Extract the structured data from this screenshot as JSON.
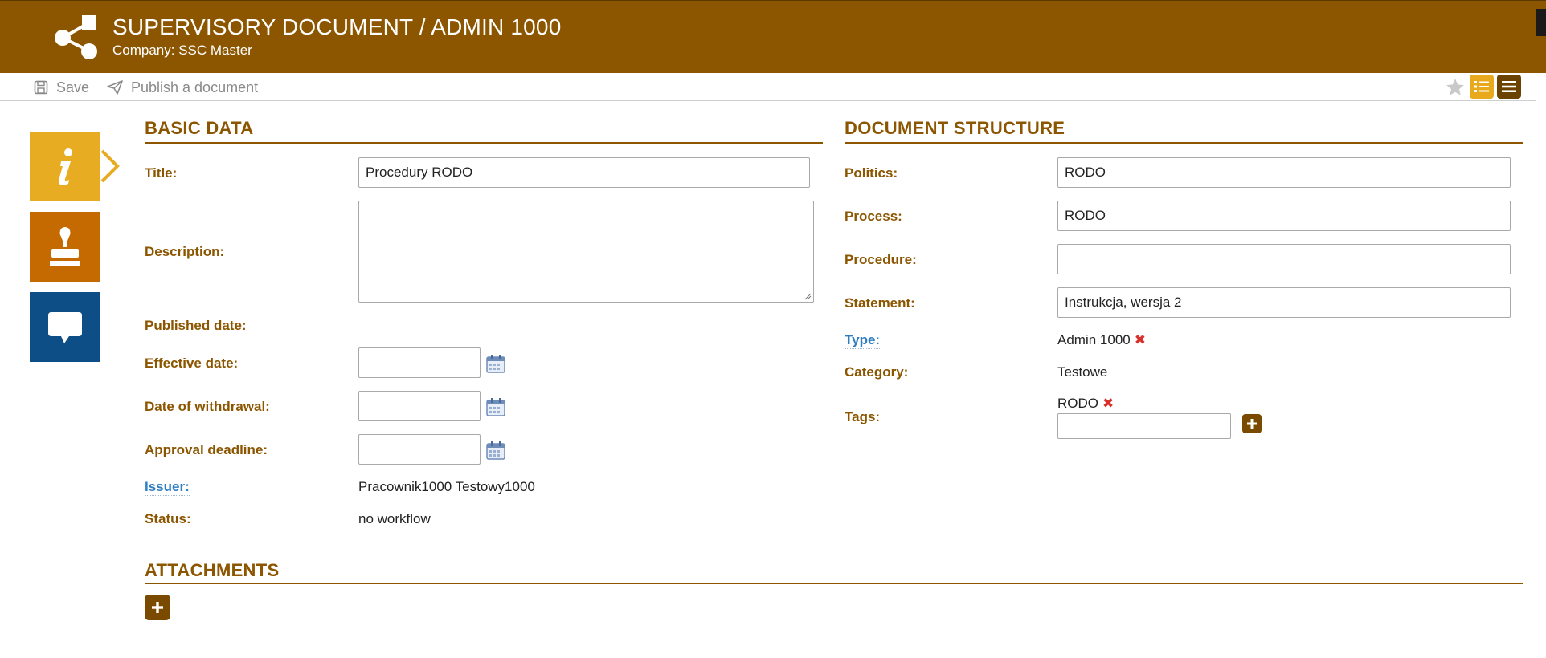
{
  "header": {
    "title": "SUPERVISORY DOCUMENT / ADMIN 1000",
    "subtitle": "Company: SSC Master"
  },
  "toolbar": {
    "save_label": "Save",
    "publish_label": "Publish a document"
  },
  "side_tabs": [
    "info-icon",
    "stamp-icon",
    "comment-icon"
  ],
  "basic": {
    "heading": "BASIC DATA",
    "title_label": "Title:",
    "title_value": "Procedury RODO",
    "description_label": "Description:",
    "description_value": "",
    "published_label": "Published date:",
    "effective_label": "Effective date:",
    "withdrawal_label": "Date of withdrawal:",
    "approval_label": "Approval deadline:",
    "issuer_label": "Issuer:",
    "issuer_value": "Pracownik1000 Testowy1000",
    "status_label": "Status:",
    "status_value": "no workflow"
  },
  "structure": {
    "heading": "DOCUMENT STRUCTURE",
    "politics_label": "Politics:",
    "politics_value": "RODO",
    "process_label": "Process:",
    "process_value": "RODO",
    "procedure_label": "Procedure:",
    "procedure_value": "",
    "statement_label": "Statement:",
    "statement_value": "Instrukcja, wersja 2",
    "type_label": "Type:",
    "type_value": "Admin 1000",
    "category_label": "Category:",
    "category_value": "Testowe",
    "tags_label": "Tags:",
    "tag_value": "RODO",
    "tag_input": ""
  },
  "attachments": {
    "heading": "ATTACHMENTS"
  },
  "colors": {
    "brand": "#8c5600",
    "accent": "#e8ac22",
    "stamp": "#c46a00",
    "comment": "#0e4e86",
    "link": "#2f7ec1",
    "remove": "#d9302b"
  }
}
